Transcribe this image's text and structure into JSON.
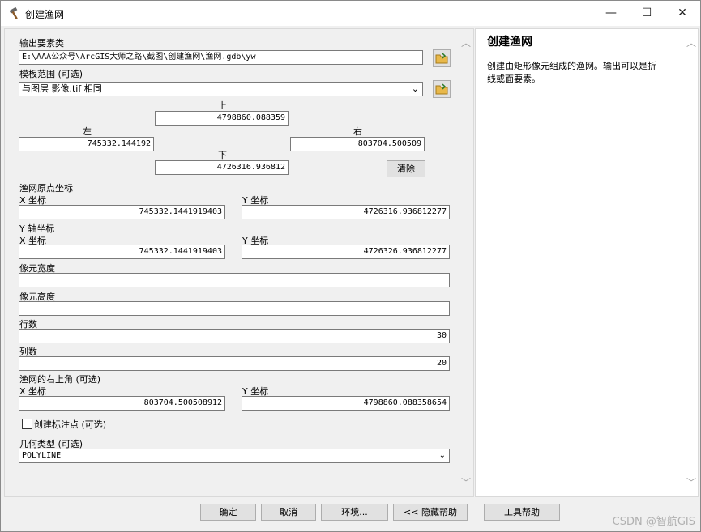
{
  "window": {
    "title": "创建渔网",
    "minimize": "—",
    "maximize": "☐",
    "close": "✕"
  },
  "form": {
    "output_label": "输出要素类",
    "output_value": "E:\\AAA公众号\\ArcGIS大师之路\\截图\\创建渔网\\渔网.gdb\\yw",
    "template_label": "模板范围 (可选)",
    "template_value": "与图层 影像.tif 相同",
    "top_label": "上",
    "top_value": "4798860.088359",
    "left_label": "左",
    "left_value": "745332.144192",
    "right_label": "右",
    "right_value": "803704.500509",
    "bottom_label": "下",
    "bottom_value": "4726316.936812",
    "clear_button": "清除",
    "origin_label": "渔网原点坐标",
    "origin_x_label": "X 坐标",
    "origin_x_value": "745332.1441919403",
    "origin_y_label": "Y 坐标",
    "origin_y_value": "4726316.936812277",
    "yaxis_label": "Y 轴坐标",
    "yaxis_x_label": "X 坐标",
    "yaxis_x_value": "745332.1441919403",
    "yaxis_y_label": "Y 坐标",
    "yaxis_y_value": "4726326.936812277",
    "cell_width_label": "像元宽度",
    "cell_width_value": "",
    "cell_height_label": "像元高度",
    "cell_height_value": "",
    "rows_label": "行数",
    "rows_value": "30",
    "cols_label": "列数",
    "cols_value": "20",
    "corner_label": "渔网的右上角 (可选)",
    "corner_x_label": "X 坐标",
    "corner_x_value": "803704.500508912",
    "corner_y_label": "Y 坐标",
    "corner_y_value": "4798860.088358654",
    "label_points": "创建标注点 (可选)",
    "label_points_checked": false,
    "geometry_label": "几何类型 (可选)",
    "geometry_value": "POLYLINE"
  },
  "help": {
    "title": "创建渔网",
    "line1": "创建由矩形像元组成的渔网。输出可以是折",
    "line2": "线或面要素。"
  },
  "buttons": {
    "ok": "确定",
    "cancel": "取消",
    "env": "环境...",
    "hide_help": "<< 隐藏帮助",
    "tool_help": "工具帮助"
  },
  "watermark": "CSDN @智航GIS"
}
